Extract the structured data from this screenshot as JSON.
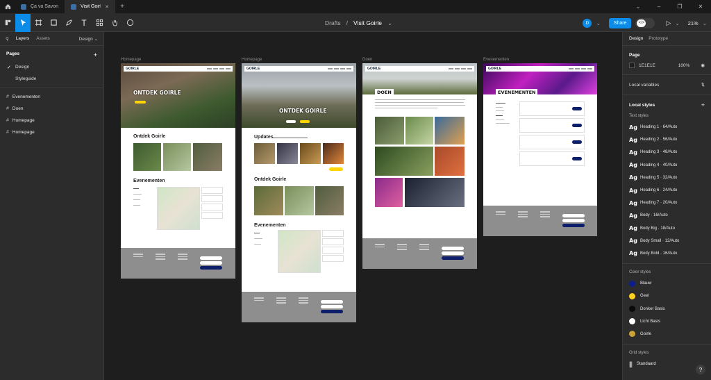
{
  "tabs": [
    {
      "label": "Ça va Savon",
      "active": false
    },
    {
      "label": "Visit Goirle",
      "active": true
    }
  ],
  "breadcrumb": {
    "project": "Drafts",
    "file": "Visit Goirle"
  },
  "toolbar": {
    "avatar": "D",
    "share": "Share",
    "zoom": "21%"
  },
  "left_panel": {
    "tab_layers": "Layers",
    "tab_assets": "Assets",
    "design_dropdown": "Design",
    "pages_title": "Pages",
    "pages": [
      {
        "label": "Design",
        "current": true
      },
      {
        "label": "Styleguide",
        "current": false
      }
    ],
    "layers": [
      "Evenementen",
      "Doen",
      "Homepage",
      "Homepage"
    ]
  },
  "canvas": {
    "frames": [
      {
        "label": "Homepage",
        "brand": "GOIRLE",
        "hero": "ONTDEK GOIRLE",
        "s1": "Ontdek Goirle",
        "s2": "Evenementen"
      },
      {
        "label": "Homepage",
        "brand": "GOIRLE",
        "hero": "ONTDEK GOIRLE",
        "s0": "Updates",
        "s1": "Ontdek Goirle",
        "s2": "Evenementen"
      },
      {
        "label": "Doen",
        "brand": "GOIRLE",
        "hero": "DOEN"
      },
      {
        "label": "Evenementen",
        "brand": "GOIRLE",
        "hero": "EVENEMENTEN"
      }
    ]
  },
  "right_panel": {
    "tab_design": "Design",
    "tab_prototype": "Prototype",
    "page_title": "Page",
    "page_color": "1E1E1E",
    "page_opacity": "100%",
    "local_variables": "Local variables",
    "local_styles": "Local styles",
    "text_styles_title": "Text styles",
    "text_styles": [
      "Heading 1 · 64/Auto",
      "Heading 2 · 56/Auto",
      "Heading 3 · 48/Auto",
      "Heading 4 · 40/Auto",
      "Heading 5 · 32/Auto",
      "Heading 6 · 24/Auto",
      "Heading 7 · 20/Auto",
      "Body · 16/Auto",
      "Body Big · 18/Auto",
      "Body Small · 12/Auto",
      "Body Bold · 16/Auto"
    ],
    "ag": "Ag",
    "color_styles_title": "Color styles",
    "color_styles": [
      {
        "name": "Blauw",
        "color": "#0d1e8c"
      },
      {
        "name": "Geel",
        "color": "#ffd21f"
      },
      {
        "name": "Donker Basis",
        "color": "#0a0a0a"
      },
      {
        "name": "Licht Basis",
        "color": "#ffffff"
      },
      {
        "name": "Goirle",
        "color": "#c9a33a"
      }
    ],
    "grid_styles_title": "Grid styles",
    "grid_styles": [
      "Standaard"
    ],
    "help": "?"
  },
  "colors": {
    "accent": "#0c8ce9",
    "panel": "#2c2c2c",
    "canvas": "#1e1e1e"
  }
}
